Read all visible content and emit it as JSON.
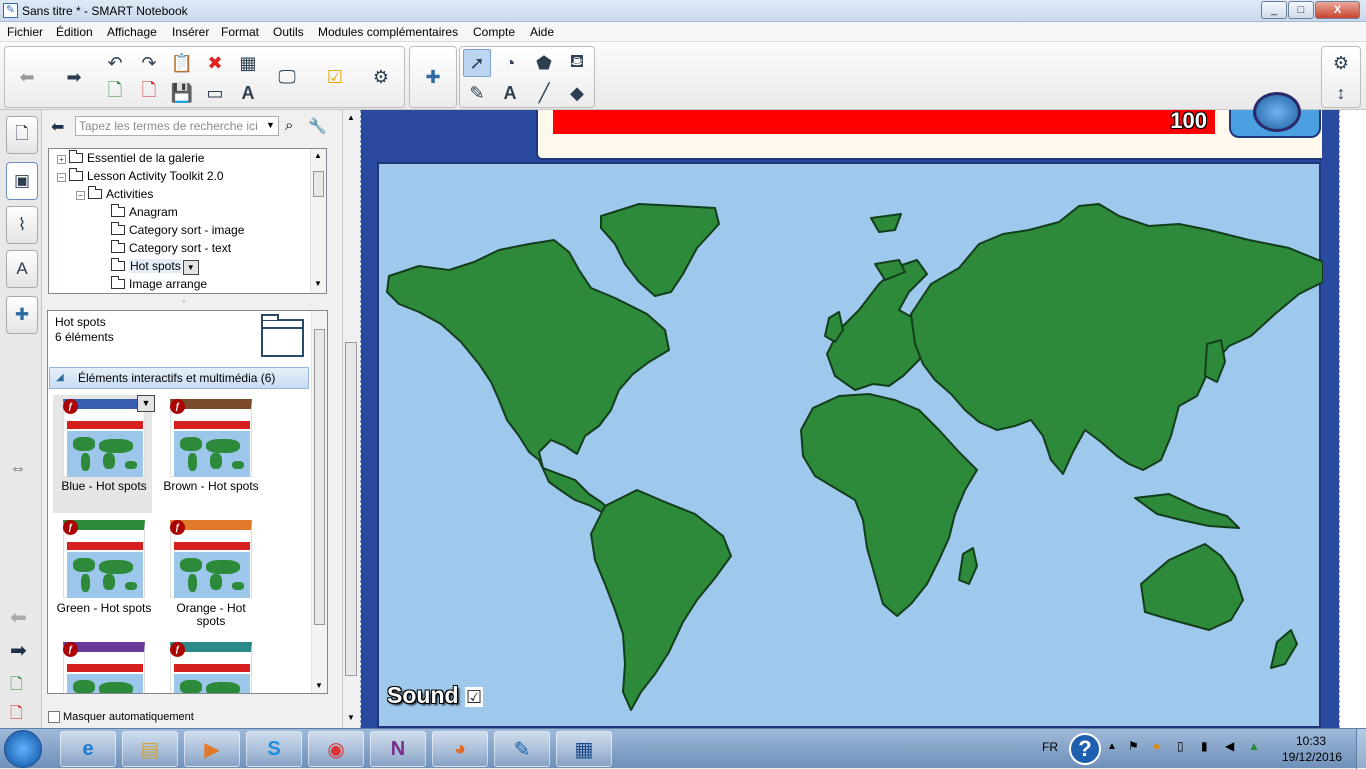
{
  "window": {
    "title": "Sans titre * - SMART Notebook",
    "icon": "notebook-app-icon",
    "controls": [
      "_",
      "□",
      "X"
    ]
  },
  "menu": [
    "Fichier",
    "Édition",
    "Affichage",
    "Insérer",
    "Format",
    "Outils",
    "Modules complémentaires",
    "Compte",
    "Aide"
  ],
  "toolbar": {
    "icons": [
      "back-arrow-icon",
      "forward-arrow-icon",
      "undo-icon",
      "redo-icon",
      "new-page-icon",
      "delete-page-icon",
      "paste-icon",
      "save-icon",
      "delete-icon",
      "screen-shade-icon",
      "table-icon",
      "text-recognition-icon",
      "display-icon",
      "activity-builder-icon",
      "add-on-icon",
      "puzzle-icon",
      "select-icon",
      "pens-icon",
      "shapes-icon",
      "text-icon",
      "eraser-icon",
      "line-icon",
      "fill-icon",
      "magic-pen-icon",
      "settings-icon",
      "move-toolbar-icon"
    ]
  },
  "gallery": {
    "search_placeholder": "Tapez les termes de recherche ici",
    "tree": [
      {
        "label": "Essentiel de la galerie",
        "level": 0,
        "expander": "+"
      },
      {
        "label": "Lesson Activity Toolkit 2.0",
        "level": 0,
        "expander": "−"
      },
      {
        "label": "Activities",
        "level": 1,
        "expander": "−"
      },
      {
        "label": "Anagram",
        "level": 2
      },
      {
        "label": "Category sort - image",
        "level": 2
      },
      {
        "label": "Category sort - text",
        "level": 2
      },
      {
        "label": "Hot spots",
        "level": 2,
        "selected": true
      },
      {
        "label": "Image arrange",
        "level": 2
      }
    ],
    "folder_name": "Hot spots",
    "folder_count": "6 éléments",
    "category": "Éléments interactifs et multimédia (6)",
    "items": [
      {
        "label": "Blue - Hot spots",
        "accent": "#3a5fb0"
      },
      {
        "label": "Brown - Hot spots",
        "accent": "#7a4a2a"
      },
      {
        "label": "Green - Hot spots",
        "accent": "#2c8a3a"
      },
      {
        "label": "Orange - Hot spots",
        "accent": "#e07a2a"
      },
      {
        "label": "",
        "accent": "#6a3a9a"
      },
      {
        "label": "",
        "accent": "#2a8a8a"
      }
    ],
    "autohide_label": "Masquer automatiquement"
  },
  "canvas": {
    "score": "100",
    "sound_label": "Sound",
    "sound_checked": "☑"
  },
  "taskbar": {
    "apps": [
      "internet-explorer",
      "file-explorer",
      "media-player",
      "skype",
      "chrome",
      "onenote",
      "firefox",
      "smart-notebook",
      "document"
    ],
    "tray": {
      "language": "FR",
      "help": "?",
      "time": "10:33",
      "date": "19/12/2016"
    }
  },
  "colors": {
    "selection_blue": "#bcd6f2",
    "page_blue": "#2a4aa0",
    "ocean": "#9fc9ec",
    "land": "#2c8a3a",
    "score_red": "#ff0000"
  }
}
